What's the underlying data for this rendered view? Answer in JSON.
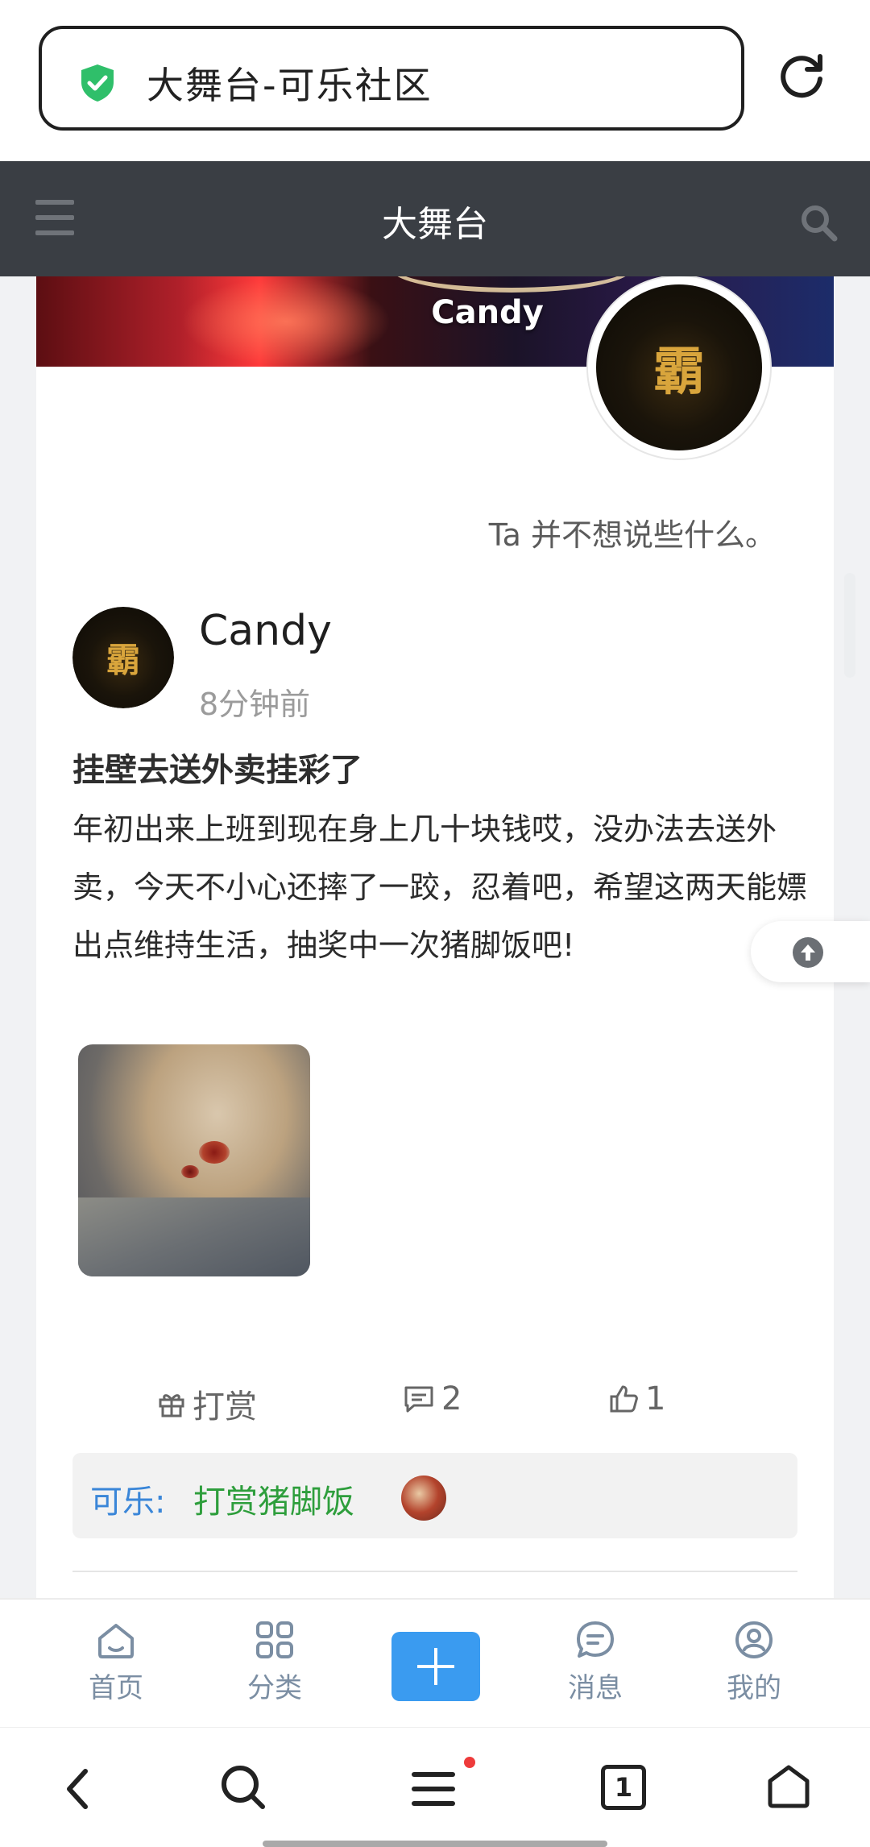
{
  "browser": {
    "address_text": "大舞台-可乐社区"
  },
  "app_header": {
    "title": "大舞台"
  },
  "profile": {
    "banner_name": "Candy",
    "bio": "Ta 并不想说些什么。"
  },
  "post": {
    "author": "Candy",
    "time": "8分钟前",
    "title": "挂壁去送外卖挂彩了",
    "body": "年初出来上班到现在身上几十块钱哎，没办法去送外卖，今天不小心还摔了一跤，忍着吧，希望这两天能嫖出点维持生活，抽奖中一次猪脚饭吧!",
    "actions": {
      "reward_label": "打赏",
      "comment_count": "2",
      "like_count": "1"
    },
    "reward": {
      "user": "可乐:",
      "text": "打赏猪脚饭"
    }
  },
  "bottom_nav": {
    "items": [
      {
        "label": "首页",
        "icon": "home-icon"
      },
      {
        "label": "分类",
        "icon": "grid-icon"
      },
      {
        "label": "消息",
        "icon": "message-icon"
      },
      {
        "label": "我的",
        "icon": "profile-icon"
      }
    ]
  },
  "browser_bar": {
    "tab_count": "1"
  },
  "colors": {
    "header_bg": "#3a3e44",
    "accent_blue": "#3a9bf0",
    "reward_user": "#3a86d8",
    "reward_text": "#2e9e3c"
  }
}
